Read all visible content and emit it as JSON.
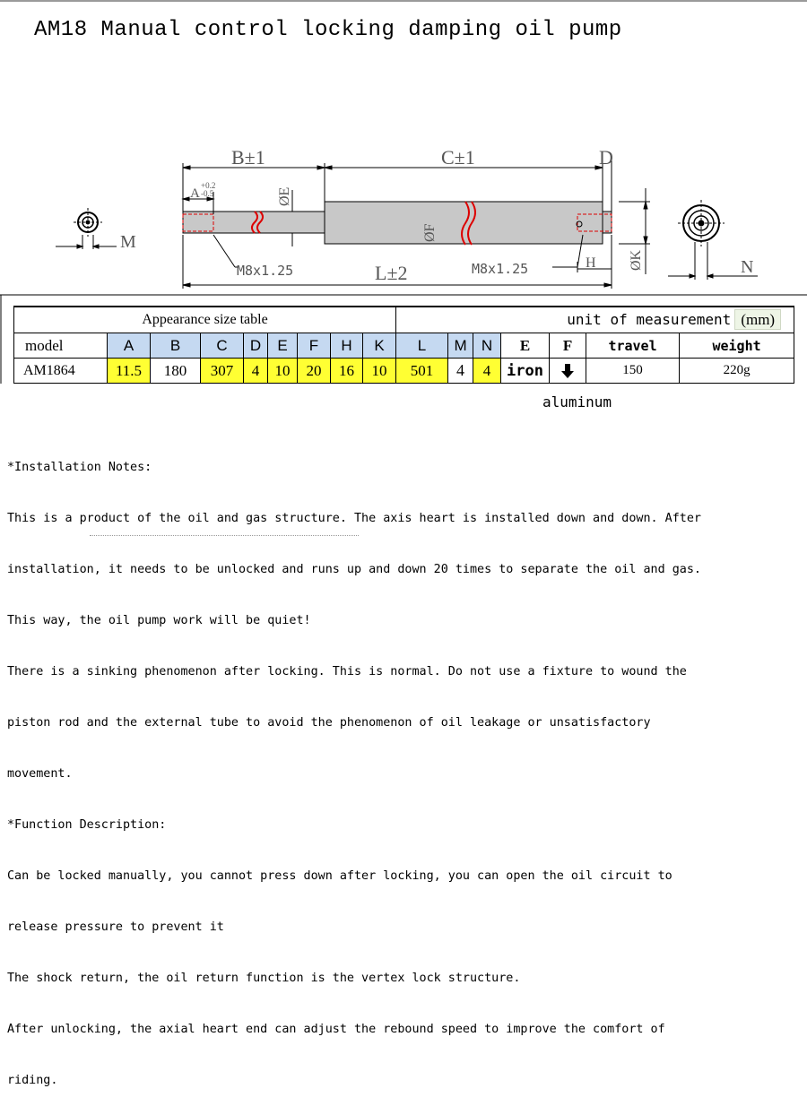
{
  "title": "AM18 Manual control locking damping oil pump",
  "drawing": {
    "b_label": "B±1",
    "c_label": "C±1",
    "d_label": "D",
    "a_label": "A",
    "a_tol_upper": "+0.2",
    "a_tol_lower": "-0.5",
    "e_label": "ØE",
    "f_label": "ØF",
    "k_label": "ØK",
    "h_label": "H",
    "m_label": "M",
    "n_label": "N",
    "l_label": "L±2",
    "thread_left": "M8x1.25",
    "thread_right": "M8x1.25"
  },
  "table": {
    "caption": "Appearance size table",
    "unit_label": "unit of measurement",
    "unit_value": "(mm)",
    "headers": {
      "model": "model",
      "A": "A",
      "B": "B",
      "C": "C",
      "D": "D",
      "E1": "E",
      "F1": "F",
      "H": "H",
      "K": "K",
      "L": "L",
      "M": "M",
      "N": "N",
      "E2": "E",
      "F2": "F",
      "travel": "travel",
      "weight": "weight"
    },
    "row": {
      "model": "AM1864",
      "A": "11.5",
      "B": "180",
      "C": "307",
      "D": "4",
      "E1": "10",
      "F1": "20",
      "H": "16",
      "K": "10",
      "L": "501",
      "M": "4",
      "N": "4",
      "E2": "iron",
      "F2_icon": "arrow-down-icon",
      "travel": "150",
      "weight": "220g"
    }
  },
  "below_table": "aluminum",
  "notes": [
    "*Installation Notes:",
    "This is a product of the oil and gas structure. The axis heart is installed down and down. After",
    "installation, it needs to be unlocked and runs up and down 20 times to separate the oil and gas.",
    "This way, the oil pump work will be quiet!",
    "There is a sinking phenomenon after locking. This is normal. Do not use a fixture to wound the",
    "piston rod and the external tube to avoid the phenomenon of oil leakage or unsatisfactory",
    "movement.",
    "*Function Description:",
    "Can be locked manually, you cannot press down after locking, you can open the oil circuit to",
    "release pressure to prevent it",
    "The shock return, the oil return function is the vertex lock structure.",
    "After unlocking, the axial heart end can adjust the rebound speed to improve the comfort of",
    "riding."
  ]
}
